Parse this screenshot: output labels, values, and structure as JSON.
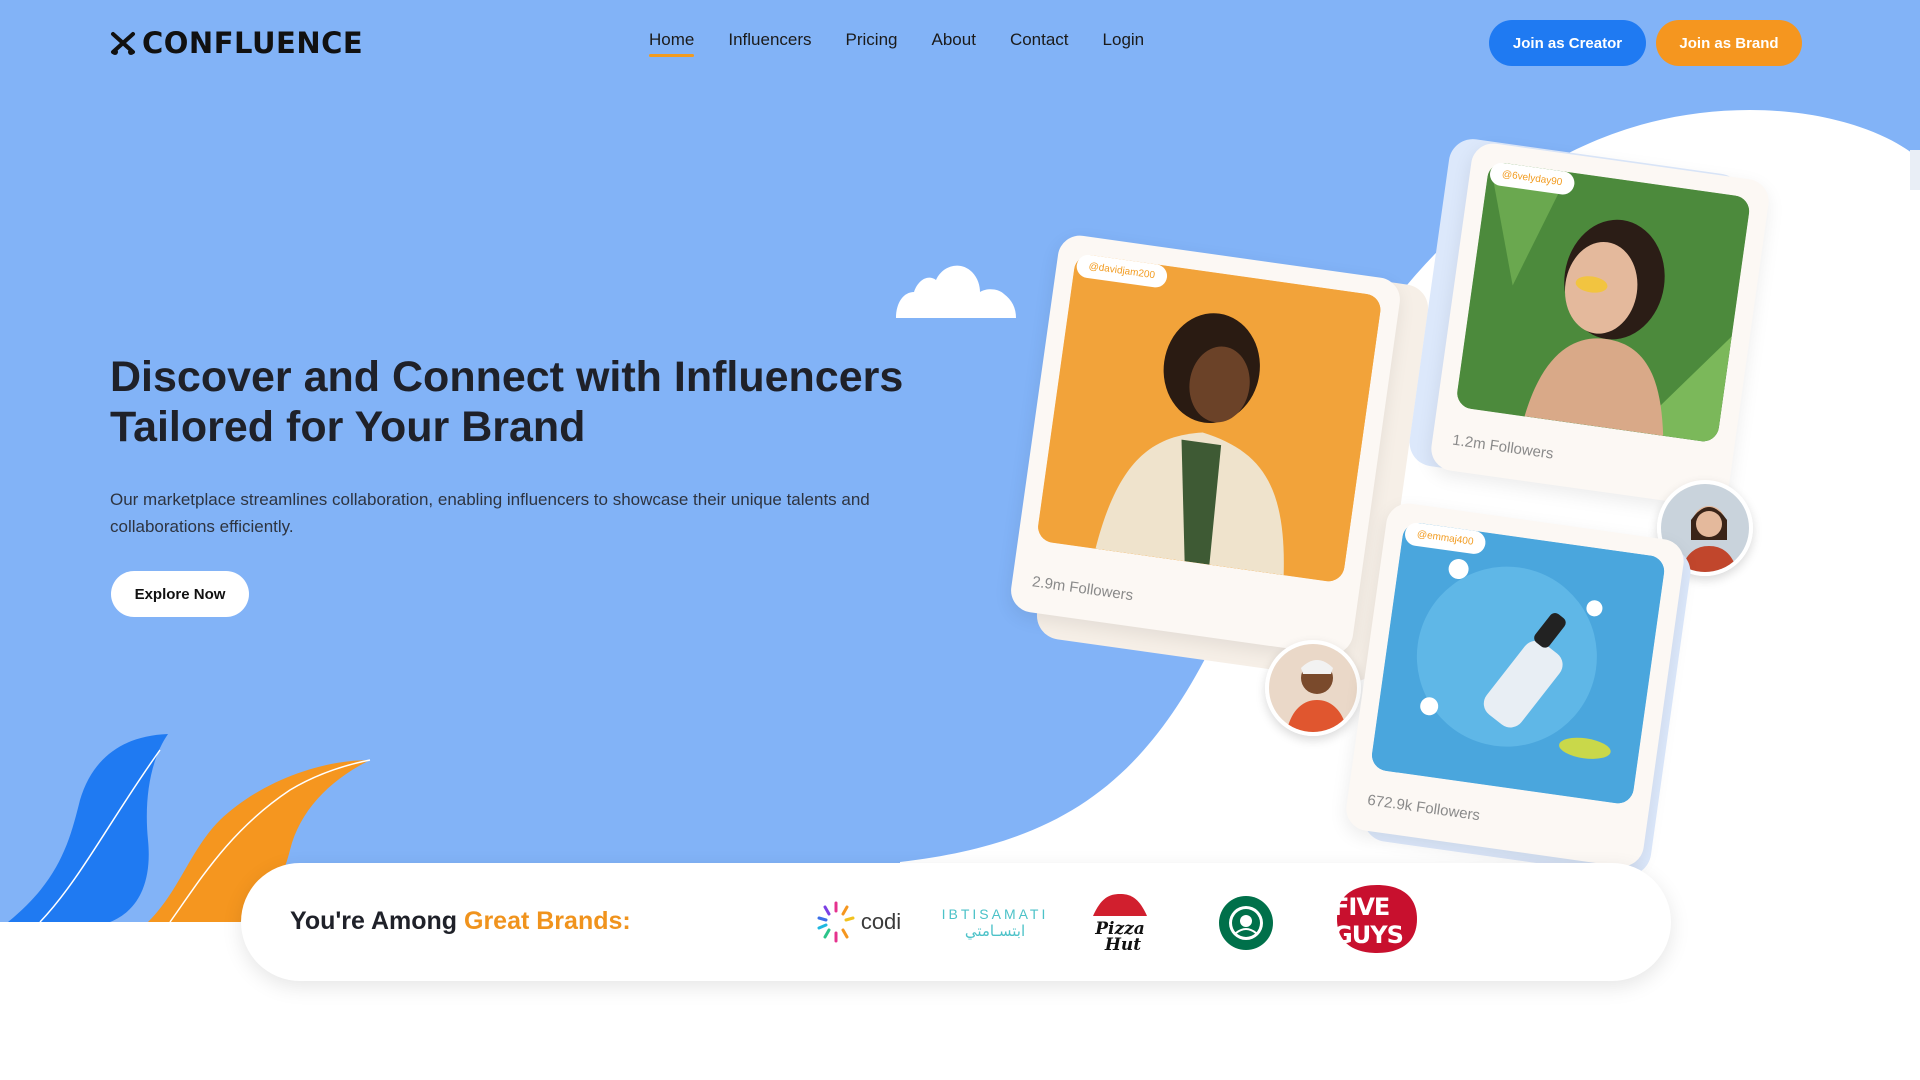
{
  "header": {
    "logo_text": "CONFLUENCE",
    "nav": [
      {
        "label": "Home",
        "active": true
      },
      {
        "label": "Influencers"
      },
      {
        "label": "Pricing"
      },
      {
        "label": "About"
      },
      {
        "label": "Contact"
      },
      {
        "label": "Login"
      }
    ],
    "join_creator": "Join as Creator",
    "join_brand": "Join as Brand"
  },
  "hero": {
    "title_line1": "Discover and Connect with Influencers",
    "title_line2": "Tailored for Your Brand",
    "description": "Our marketplace streamlines collaboration, enabling influencers to showcase their unique talents and collaborations efficiently.",
    "cta": "Explore Now"
  },
  "cards": [
    {
      "handle": "@davidjam200",
      "followers": "2.9m Followers"
    },
    {
      "handle": "@6velyday90",
      "followers": "1.2m Followers"
    },
    {
      "handle": "@emmaj400",
      "followers": "672.9k Followers"
    }
  ],
  "brands": {
    "title_prefix": "You're Among ",
    "title_accent": "Great Brands:",
    "logos": [
      {
        "name": "codi",
        "text": "codi"
      },
      {
        "name": "ibtisamati",
        "text_en": "IBTISAMATI",
        "text_ar": "ابتسـامتي"
      },
      {
        "name": "pizza-hut",
        "text": "Pizza Hut"
      },
      {
        "name": "starbucks",
        "text": "STARBUCKS COFFEE"
      },
      {
        "name": "five-guys",
        "text": "FIVE GUYS"
      }
    ]
  },
  "colors": {
    "hero_bg": "#82b3f7",
    "primary_blue": "#1f7af2",
    "accent_orange": "#f5961f"
  }
}
